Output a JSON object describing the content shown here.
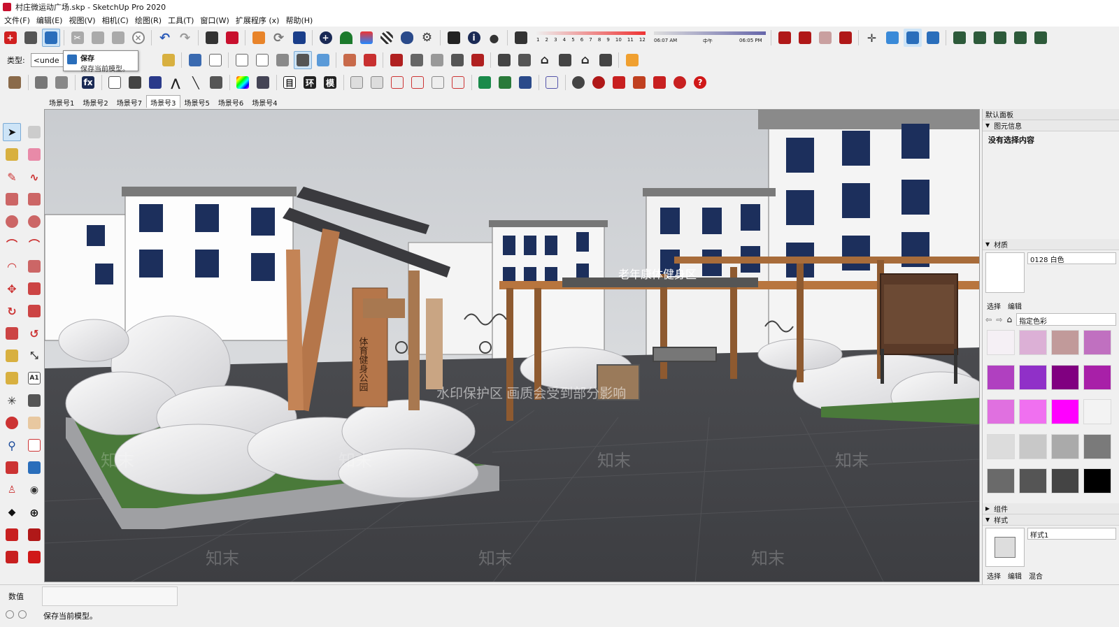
{
  "window": {
    "title": "村庄微运动广场.skp - SketchUp Pro 2020"
  },
  "menu": [
    "文件(F)",
    "编辑(E)",
    "视图(V)",
    "相机(C)",
    "绘图(R)",
    "工具(T)",
    "窗口(W)",
    "扩展程序 (x)",
    "帮助(H)"
  ],
  "toolbar": {
    "type_label": "类型:",
    "type_value": "<unde",
    "shadow_months": [
      "1",
      "2",
      "3",
      "4",
      "5",
      "6",
      "7",
      "8",
      "9",
      "10",
      "11",
      "12"
    ],
    "time_start": "06:07 AM",
    "time_mid": "中午",
    "time_end": "06:05 PM",
    "table_btn": "目",
    "env_btn": "环",
    "model_btn": "模"
  },
  "tooltip": {
    "title": "保存",
    "description": "保存当前模型。"
  },
  "scene_tabs": [
    "场景号1",
    "场景号2",
    "场景号7",
    "场景号3",
    "场景号5",
    "场景号6",
    "场景号4"
  ],
  "active_scene": "场景号3",
  "viewport": {
    "watermark_main": "水印保护区  画质会受到部分影响",
    "watermark_brand": "知末",
    "sign_fitness": "老年康体健身区",
    "sign_vertical": "体育健身公园"
  },
  "right_panel": {
    "default_panel": "默认面板",
    "entity_info": {
      "label": "图元信息",
      "content": "没有选择内容"
    },
    "materials": {
      "label": "材质",
      "current": "0128 白色",
      "tab_select": "选择",
      "tab_edit": "编辑",
      "library": "指定色彩",
      "swatches": [
        "#f5f0f5",
        "#dcb0d6",
        "#c19a9a",
        "#c070c0",
        "#b040c0",
        "#9030c8",
        "#800080",
        "#a820a8",
        "#e070e0",
        "#f070f0",
        "#ff00ff",
        "#f3f3f3",
        "#dcdcdc",
        "#c8c8c8",
        "#aaaaaa",
        "#7a7a7a",
        "#6a6a6a",
        "#555555",
        "#444444",
        "#000000"
      ]
    },
    "components": {
      "label": "组件"
    },
    "styles": {
      "label": "样式",
      "current": "样式1",
      "tab_select": "选择",
      "tab_edit": "编辑",
      "tab_mix": "混合"
    }
  },
  "statusbar": {
    "measure_label": "数值",
    "status_text": "保存当前模型。"
  },
  "colors": {
    "accent_red": "#c8102e",
    "accent_blue": "#2a6ebb"
  }
}
